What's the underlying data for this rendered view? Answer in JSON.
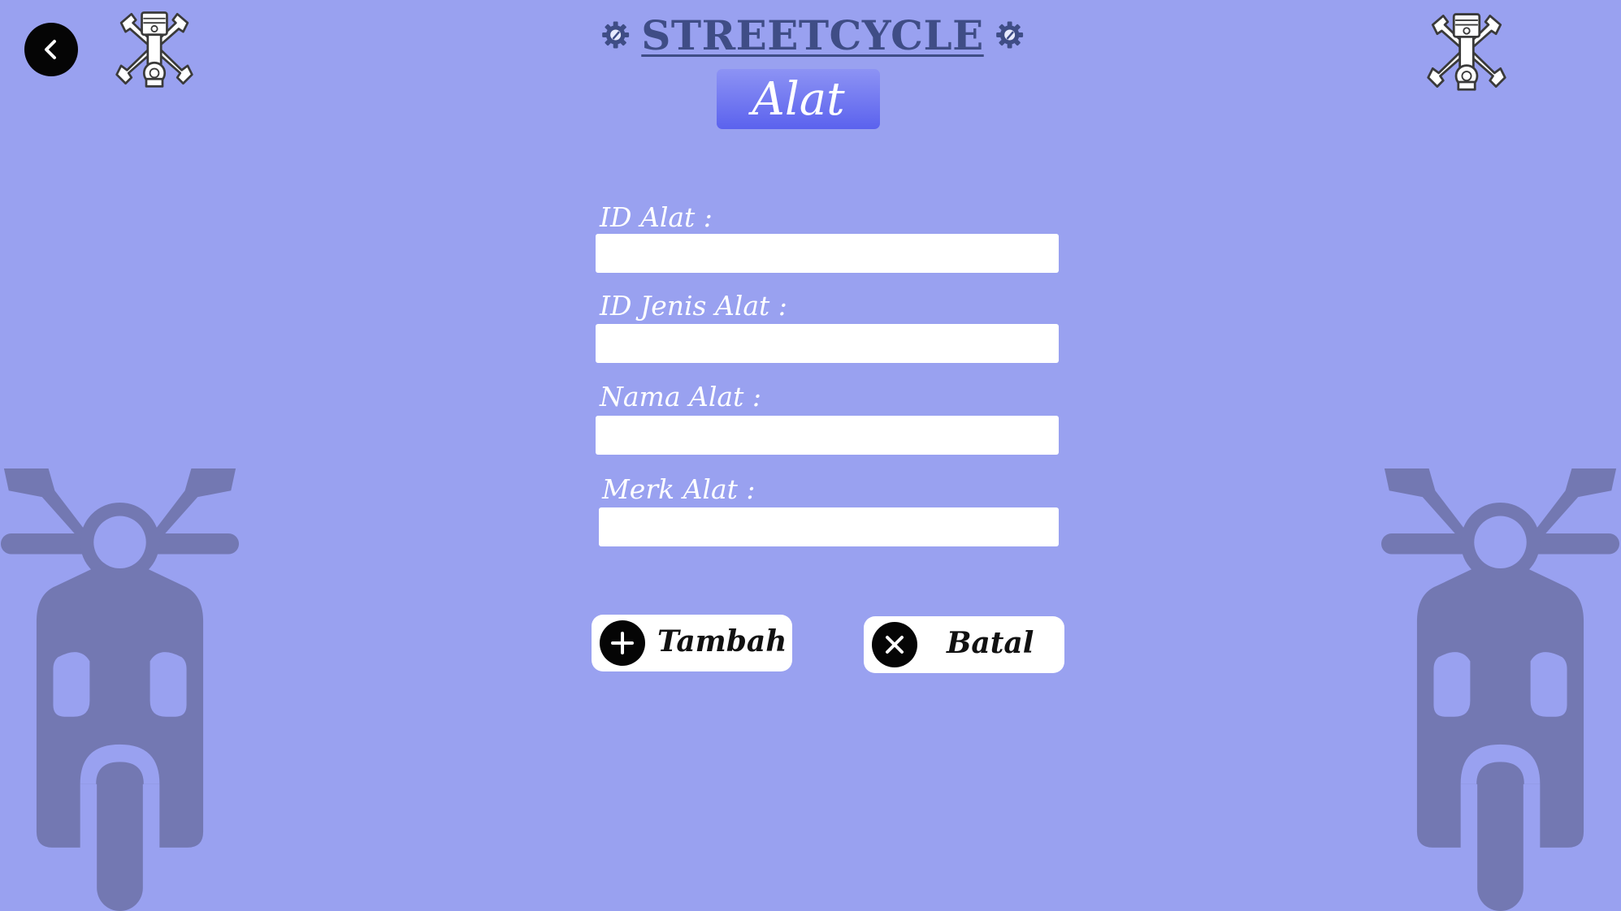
{
  "header": {
    "app_title": "STREETCYCLE",
    "page_title": "Alat"
  },
  "form": {
    "fields": [
      {
        "label": "ID Alat :",
        "value": ""
      },
      {
        "label": "ID Jenis Alat :",
        "value": ""
      },
      {
        "label": "Nama Alat :",
        "value": ""
      },
      {
        "label": "Merk Alat :",
        "value": ""
      }
    ]
  },
  "actions": {
    "add_label": "Tambah",
    "cancel_label": "Batal"
  },
  "icons": {
    "back": "chevron-left-icon",
    "gear": "gear-icon",
    "mechanic_logo": "piston-wrench-icon",
    "motorcycle": "scooter-icon",
    "add": "plus-icon",
    "cancel": "close-icon"
  },
  "colors": {
    "background": "#99a1f0",
    "brand_text": "#3f4d86",
    "badge_top": "#8d93f4",
    "badge_bottom": "#5b62ee",
    "silhouette": "#7378b2"
  }
}
